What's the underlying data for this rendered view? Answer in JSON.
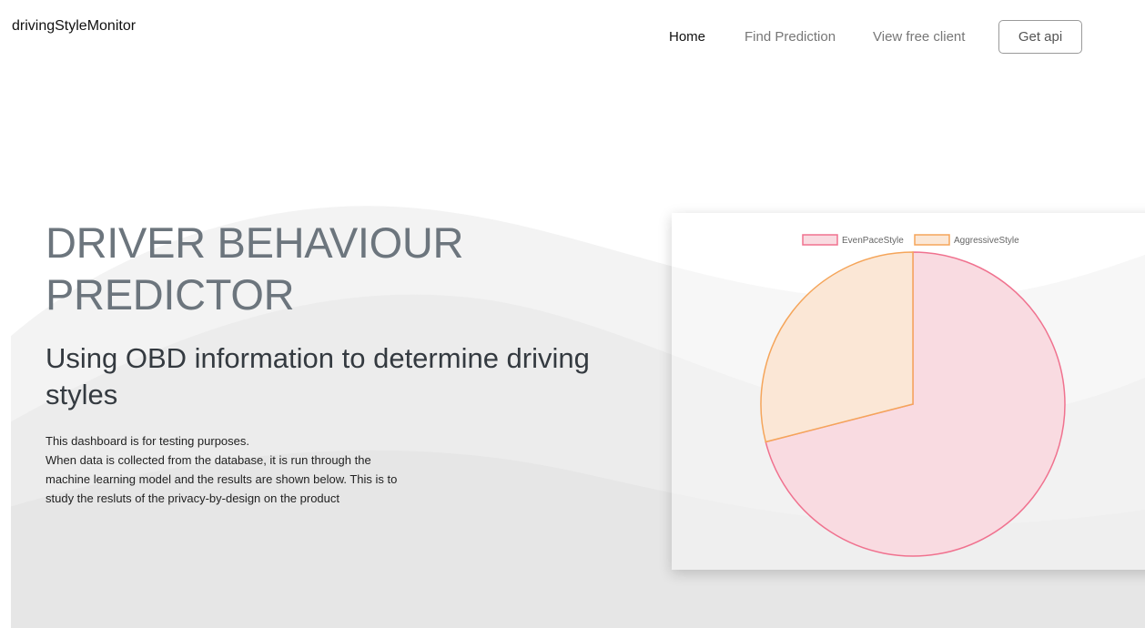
{
  "brand": "drivingStyleMonitor",
  "nav": {
    "home": "Home",
    "find_prediction": "Find Prediction",
    "view_free_client": "View free client",
    "get_api": "Get api"
  },
  "hero": {
    "title": "DRIVER BEHAVIOUR PREDICTOR",
    "subtitle": "Using OBD information to determine driving styles",
    "description_lines": [
      "This dashboard is for testing purposes.",
      "When data is collected from the database, it is run through the",
      "machine learning model and the results are shown below. This is to",
      "study the resluts of the privacy-by-design on the product"
    ]
  },
  "chart_data": {
    "type": "pie",
    "legend_position": "top",
    "categories": [
      "EvenPaceStyle",
      "AggressiveStyle"
    ],
    "values": [
      71,
      29
    ],
    "colors": {
      "EvenPaceStyle": {
        "fill": "#f9dbe1",
        "stroke": "#f0728f"
      },
      "AggressiveStyle": {
        "fill": "#fbe7d6",
        "stroke": "#f5a55a"
      }
    }
  }
}
